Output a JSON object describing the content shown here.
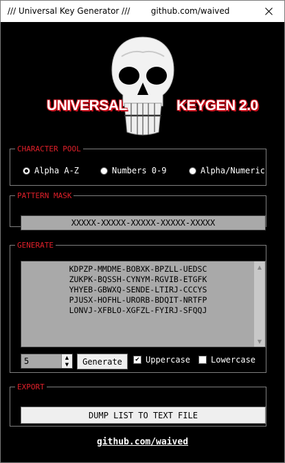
{
  "window": {
    "title": "/// Universal Key Generator ///        github.com/waived",
    "close_glyph": "✕"
  },
  "logo": {
    "left_text": "UNIVERSAL",
    "right_text": "KEYGEN 2.0"
  },
  "character_pool": {
    "legend": "CHARACTER POOL",
    "options": [
      {
        "label": "Alpha A-Z",
        "checked": true
      },
      {
        "label": "Numbers 0-9",
        "checked": false
      },
      {
        "label": "Alpha/Numeric",
        "checked": false
      }
    ]
  },
  "pattern_mask": {
    "legend": "PATTERN MASK",
    "value": "XXXXX-XXXXX-XXXXX-XXXXX-XXXXX"
  },
  "generate": {
    "legend": "GENERATE",
    "keys": [
      "KDPZP-MMDME-BOBXK-BPZLL-UEDSC",
      "ZUKPK-BQSSH-CYNYM-RGVIB-ETGFK",
      "YHYEB-GBWXQ-SENDE-LTIRJ-CCCYS",
      "PJUSX-HOFHL-URORB-BDQIT-NRTFP",
      "LONVJ-XFBLO-XGFZL-FYIRJ-SFQQJ"
    ],
    "count": "5",
    "button_label": "Generate",
    "uppercase_label": "Uppercase",
    "uppercase_checked": true,
    "lowercase_label": "Lowercase",
    "lowercase_checked": false
  },
  "export": {
    "legend": "EXPORT",
    "button_label": "DUMP LIST TO TEXT FILE"
  },
  "footer": {
    "link_text": "github.com/waived"
  }
}
